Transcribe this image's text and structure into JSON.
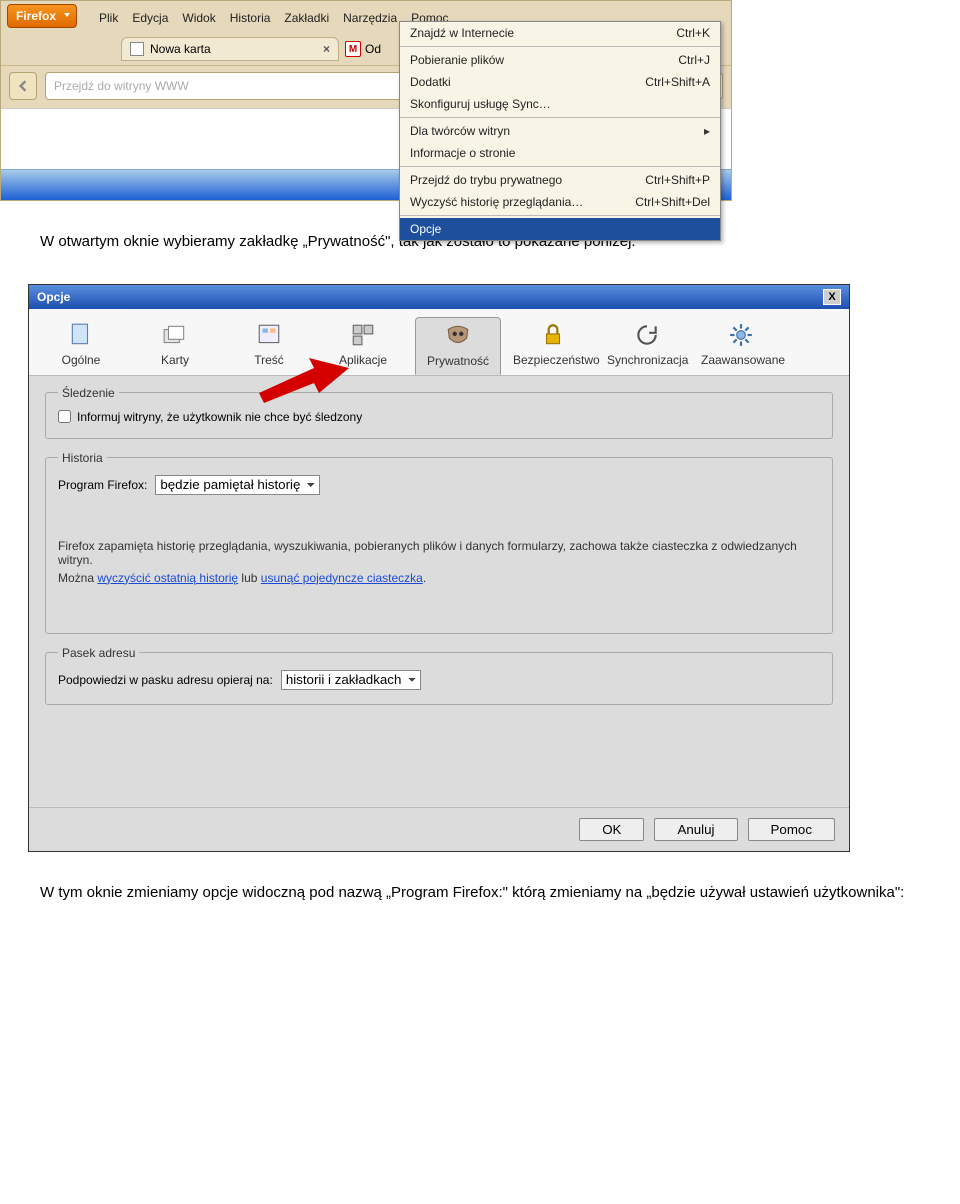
{
  "ff": {
    "brand": "Firefox",
    "menus": [
      "Plik",
      "Edycja",
      "Widok",
      "Historia",
      "Zakładki",
      "Narzędzia",
      "Pomoc"
    ],
    "tab_label": "Nowa karta",
    "tab2_prefix": "Od",
    "url_placeholder": "Przejdź do witryny WWW",
    "tools": {
      "items": [
        {
          "label": "Znajdź w Internecie",
          "shortcut": "Ctrl+K"
        },
        {
          "sep": true
        },
        {
          "label": "Pobieranie plików",
          "shortcut": "Ctrl+J"
        },
        {
          "label": "Dodatki",
          "shortcut": "Ctrl+Shift+A"
        },
        {
          "label": "Skonfiguruj usługę Sync…",
          "shortcut": ""
        },
        {
          "sep": true
        },
        {
          "label": "Dla twórców witryn",
          "shortcut": "",
          "submenu": true
        },
        {
          "label": "Informacje o stronie",
          "shortcut": ""
        },
        {
          "sep": true
        },
        {
          "label": "Przejdź do trybu prywatnego",
          "shortcut": "Ctrl+Shift+P"
        },
        {
          "label": "Wyczyść historię przeglądania…",
          "shortcut": "Ctrl+Shift+Del"
        },
        {
          "sep": true
        },
        {
          "label": "Opcje",
          "shortcut": "",
          "highlight": true
        }
      ]
    }
  },
  "para1": "W otwartym oknie wybieramy zakładkę „Prywatność\", tak jak zostało to pokazane poniżej:",
  "para2": "W tym oknie zmieniamy opcje widoczną pod nazwą „Program Firefox:\" którą zmieniamy na „będzie używał ustawień użytkownika\":",
  "opt": {
    "title": "Opcje",
    "tabs": [
      "Ogólne",
      "Karty",
      "Treść",
      "Aplikacje",
      "Prywatność",
      "Bezpieczeństwo",
      "Synchronizacja",
      "Zaawansowane"
    ],
    "tracking_legend": "Śledzenie",
    "tracking_label": "Informuj witryny, że użytkownik nie chce być śledzony",
    "history_legend": "Historia",
    "history_label": "Program Firefox:",
    "history_select": "będzie pamiętał historię",
    "history_info1": "Firefox zapamięta historię przeglądania, wyszukiwania, pobieranych plików i danych formularzy, zachowa także ciasteczka z odwiedzanych witryn.",
    "history_info2_pre": "Można ",
    "history_link1": "wyczyścić ostatnią historię",
    "history_info2_mid": " lub ",
    "history_link2": "usunąć pojedyncze ciasteczka",
    "history_info2_post": ".",
    "addr_legend": "Pasek adresu",
    "addr_label": "Podpowiedzi w pasku adresu opieraj na:",
    "addr_select": "historii i zakładkach",
    "btn_ok": "OK",
    "btn_cancel": "Anuluj",
    "btn_help": "Pomoc"
  }
}
